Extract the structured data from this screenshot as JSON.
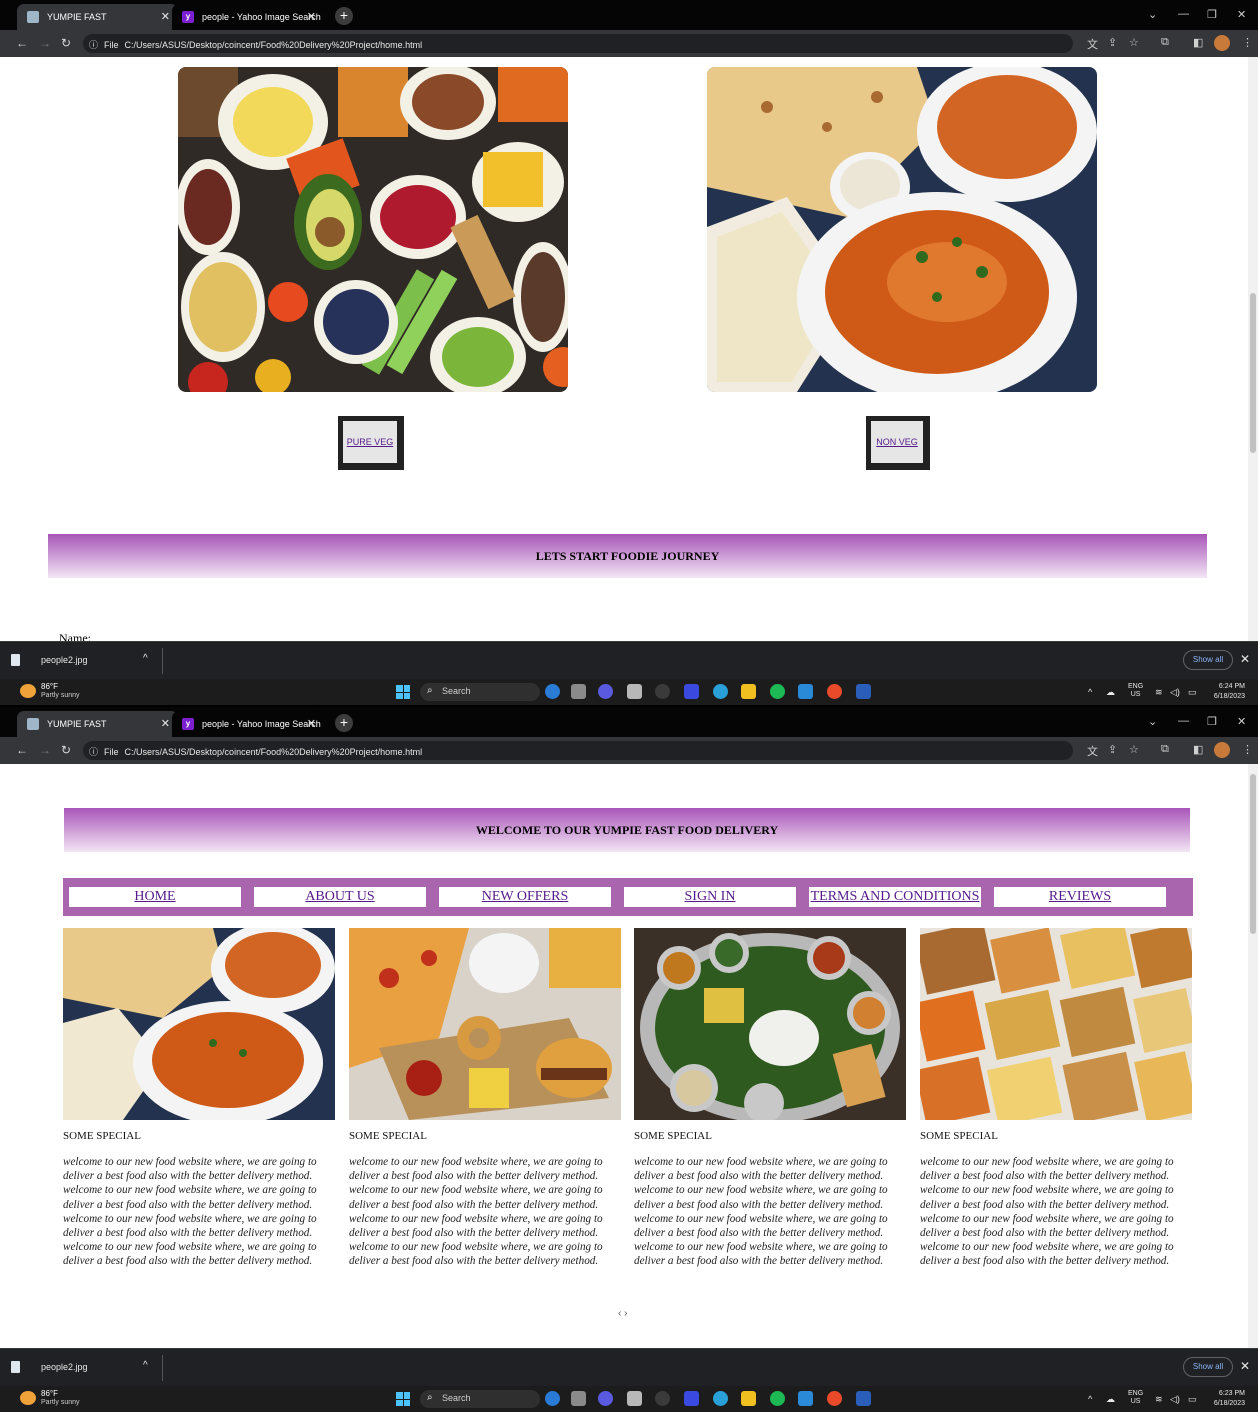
{
  "browser": {
    "tabs": [
      {
        "title": "YUMPIE FAST"
      },
      {
        "title": "people - Yahoo Image Search R"
      }
    ],
    "file_chip": "File",
    "url": "C:/Users/ASUS/Desktop/coincent/Food%20Delivery%20Project/home.html"
  },
  "downloads": {
    "file": "people2.jpg",
    "show_all": "Show all"
  },
  "taskbar": {
    "temp": "86°F",
    "weather": "Partly sunny",
    "search": "Search",
    "lang": "ENG",
    "region": "US",
    "date": "6/18/2023"
  },
  "shot1": {
    "time": "6:24 PM",
    "buttons": [
      "PURE VEG",
      "NON VEG"
    ],
    "banner": "LETS START FOODIE JOURNEY",
    "name_label": "Name:"
  },
  "shot2": {
    "time": "6:23 PM",
    "header": "WELCOME TO OUR YUMPIE FAST FOOD DELIVERY",
    "nav": [
      "HOME",
      "ABOUT US",
      "NEW OFFERS",
      "SIGN IN",
      "TERMS AND CONDITIONS",
      "REVIEWS"
    ],
    "cards": [
      {
        "title": "SOME SPECIAL",
        "text": "welcome to our new food website where, we are going to deliver a best food also with the better delivery method. welcome to our new food website where, we are going to deliver a best food also with the better delivery method. welcome to our new food website where, we are going to deliver a best food also with the better delivery method. welcome to our new food website where, we are going to deliver a best food also with the better delivery method."
      },
      {
        "title": "SOME SPECIAL",
        "text": "welcome to our new food website where, we are going to deliver a best food also with the better delivery method. welcome to our new food website where, we are going to deliver a best food also with the better delivery method. welcome to our new food website where, we are going to deliver a best food also with the better delivery method. welcome to our new food website where, we are going to deliver a best food also with the better delivery method."
      },
      {
        "title": "SOME SPECIAL",
        "text": "welcome to our new food website where, we are going to deliver a best food also with the better delivery method. welcome to our new food website where, we are going to deliver a best food also with the better delivery method. welcome to our new food website where, we are going to deliver a best food also with the better delivery method. welcome to our new food website where, we are going to deliver a best food also with the better delivery method."
      },
      {
        "title": "SOME SPECIAL",
        "text": "welcome to our new food website where, we are going to deliver a best food also with the better delivery method. welcome to our new food website where, we are going to deliver a best food also with the better delivery method. welcome to our new food website where, we are going to deliver a best food also with the better delivery method. welcome to our new food website where, we are going to deliver a best food also with the better delivery method."
      }
    ],
    "arrows": "‹ ›"
  }
}
